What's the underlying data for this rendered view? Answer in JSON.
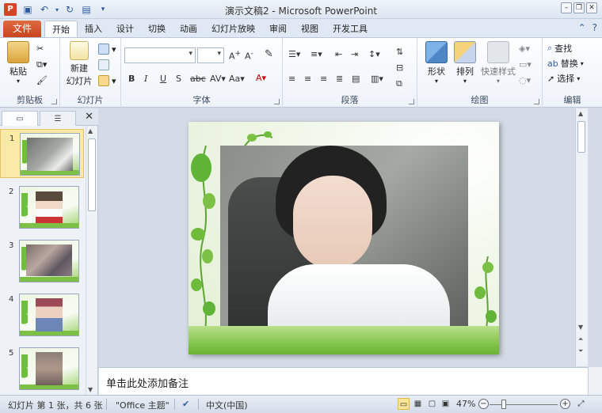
{
  "window": {
    "title": "演示文稿2 - Microsoft PowerPoint",
    "app_icon": "P",
    "controls": [
      "minimize-icon",
      "restore-icon",
      "close-icon"
    ]
  },
  "quick_access": [
    "save-icon",
    "undo-icon",
    "redo-icon",
    "slideshow-icon",
    "customize-icon"
  ],
  "ribbon_tabs": {
    "file": "文件",
    "items": [
      "开始",
      "插入",
      "设计",
      "切换",
      "动画",
      "幻灯片放映",
      "审阅",
      "视图",
      "开发工具"
    ],
    "active_index": 0
  },
  "ribbon": {
    "clipboard": {
      "label": "剪贴板",
      "paste": "粘贴"
    },
    "slides": {
      "label": "幻灯片",
      "new_slide_line1": "新建",
      "new_slide_line2": "幻灯片"
    },
    "font": {
      "label": "字体",
      "font_name": "",
      "font_size": ""
    },
    "paragraph": {
      "label": "段落"
    },
    "drawing": {
      "label": "绘图",
      "shapes": "形状",
      "arrange": "排列",
      "quick_styles": "快速样式"
    },
    "editing": {
      "label": "编辑",
      "find": "查找",
      "replace": "替换",
      "select": "选择"
    }
  },
  "slide_pane": {
    "slides": [
      {
        "number": "1"
      },
      {
        "number": "2"
      },
      {
        "number": "3"
      },
      {
        "number": "4"
      },
      {
        "number": "5"
      }
    ],
    "selected_index": 0
  },
  "notes": {
    "placeholder": "单击此处添加备注"
  },
  "status": {
    "slide_info": "幻灯片 第 1 张，共 6 张",
    "theme": "\"Office 主题\"",
    "language": "中文(中国)",
    "zoom": "47%",
    "zoom_level": 0.47
  },
  "colors": {
    "file_tab": "#c8441f",
    "grass": "#7cc145",
    "selection": "#fbe9a8"
  }
}
